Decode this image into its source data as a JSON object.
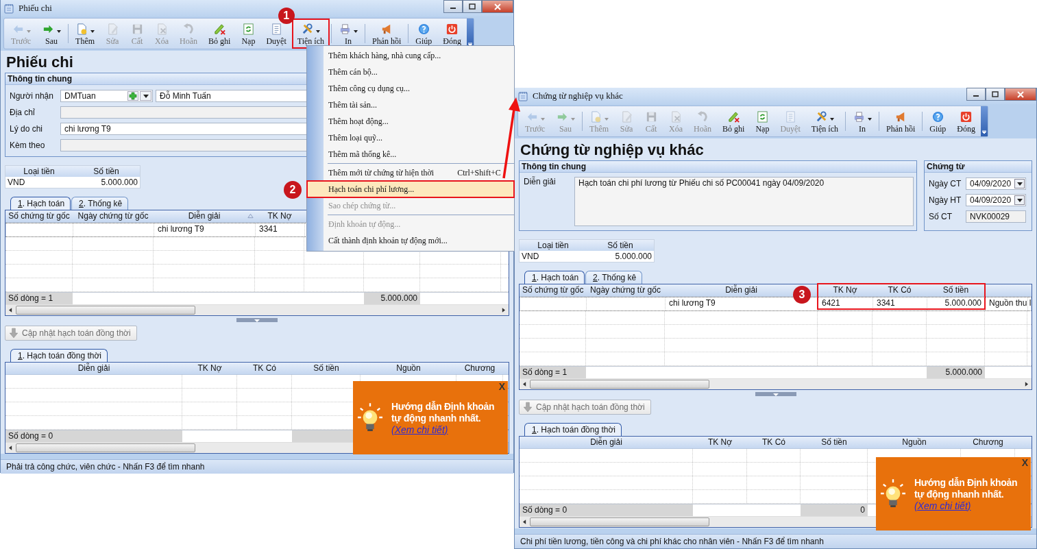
{
  "windows": [
    {
      "title": "Phiếu chi",
      "toolbar": [
        [
          {
            "label": "Trước",
            "disabled": true,
            "dropdown": true
          },
          {
            "label": "Sau",
            "disabled": false,
            "dropdown": true
          }
        ],
        [
          {
            "label": "Thêm",
            "disabled": false,
            "dropdown": true
          },
          {
            "label": "Sửa",
            "disabled": true,
            "dropdown": false
          },
          {
            "label": "Cất",
            "disabled": true,
            "dropdown": false
          },
          {
            "label": "Xóa",
            "disabled": true,
            "dropdown": false
          },
          {
            "label": "Hoãn",
            "disabled": true,
            "dropdown": false
          },
          {
            "label": "Bỏ ghi",
            "disabled": false,
            "dropdown": false
          },
          {
            "label": "Nạp",
            "disabled": false,
            "dropdown": false
          },
          {
            "label": "Duyệt",
            "disabled": false,
            "dropdown": false
          },
          {
            "label": "Tiện ích",
            "disabled": false,
            "dropdown": true,
            "callout": "1"
          }
        ],
        [
          {
            "label": "In",
            "disabled": false,
            "dropdown": true
          }
        ],
        [
          {
            "label": "Phản hồi",
            "disabled": false,
            "dropdown": false
          }
        ],
        [
          {
            "label": "Giúp",
            "disabled": false,
            "dropdown": false
          },
          {
            "label": "Đóng",
            "disabled": false,
            "dropdown": false
          }
        ]
      ],
      "heading": "Phiếu chi",
      "general": {
        "title": "Thông tin chung",
        "fields": [
          {
            "kind": "lookup",
            "label": "Người nhận",
            "value": "DMTuan",
            "name_value": "Đỗ Minh Tuấn"
          },
          {
            "kind": "text",
            "label": "Địa chỉ"
          },
          {
            "kind": "text",
            "label": "Lý do chi",
            "value": "chi lương T9"
          },
          {
            "kind": "text",
            "label": "Kèm theo"
          }
        ]
      },
      "currency": {
        "columns": [
          "Loại tiền",
          "Số tiền"
        ],
        "row": [
          "VND",
          "5.000.000"
        ]
      },
      "tabs": [
        {
          "label": "1. Hạch toán",
          "selected": true
        },
        {
          "label": "2. Thống kê",
          "selected": false
        }
      ],
      "grid": {
        "columns": [
          "Số chứng từ gốc",
          "Ngày chứng từ gốc",
          "Diễn giải",
          "TK Nợ"
        ],
        "sort_ascending": true,
        "rows": [
          [
            null,
            null,
            "chi lương T9",
            "3341"
          ]
        ],
        "footer": {
          "count": "Số dòng = 1",
          "total": "5.000.000"
        }
      },
      "update_button": {
        "label": "Cập nhật hạch toán đồng thời",
        "disabled": true
      },
      "tabs2": [
        {
          "label": "1. Hạch toán đồng thời",
          "selected": true
        }
      ],
      "grid2": {
        "columns": [
          "Diễn giải",
          "TK Nợ",
          "TK Có",
          "Số tiền",
          "Nguồn",
          "Chương"
        ],
        "footer": {
          "count": "Số dòng = 0"
        }
      },
      "popup": {
        "title": "Hướng dẫn Định khoản tự động nhanh nhất.",
        "link": "(Xem chi tiết)",
        "close": "X"
      },
      "status": "Phải trả công chức, viên chức - Nhấn F3 để tìm nhanh"
    },
    {
      "title": "Chứng từ nghiệp vụ khác",
      "toolbar": [
        [
          {
            "label": "Trước",
            "disabled": true,
            "dropdown": true
          },
          {
            "label": "Sau",
            "disabled": true,
            "dropdown": true
          }
        ],
        [
          {
            "label": "Thêm",
            "disabled": true,
            "dropdown": true
          },
          {
            "label": "Sửa",
            "disabled": true,
            "dropdown": false
          },
          {
            "label": "Cất",
            "disabled": true,
            "dropdown": false
          },
          {
            "label": "Xóa",
            "disabled": true,
            "dropdown": false
          },
          {
            "label": "Hoãn",
            "disabled": true,
            "dropdown": false
          },
          {
            "label": "Bỏ ghi",
            "disabled": false,
            "dropdown": false
          },
          {
            "label": "Nạp",
            "disabled": false,
            "dropdown": false
          },
          {
            "label": "Duyệt",
            "disabled": true,
            "dropdown": false
          },
          {
            "label": "Tiện ích",
            "disabled": false,
            "dropdown": true
          }
        ],
        [
          {
            "label": "In",
            "disabled": false,
            "dropdown": true
          }
        ],
        [
          {
            "label": "Phản hồi",
            "disabled": false,
            "dropdown": false
          }
        ],
        [
          {
            "label": "Giúp",
            "disabled": false,
            "dropdown": false
          },
          {
            "label": "Đóng",
            "disabled": false,
            "dropdown": false
          }
        ]
      ],
      "heading": "Chứng từ nghiệp vụ khác",
      "general": {
        "title": "Thông tin chung",
        "fields": [
          {
            "kind": "memo",
            "label": "Diễn giải",
            "value": "Hạch toán chi phí lương từ Phiếu chi số PC00041 ngày 04/09/2020"
          }
        ]
      },
      "voucher": {
        "title": "Chứng từ",
        "fields": [
          {
            "kind": "date",
            "label": "Ngày CT",
            "value": "04/09/2020"
          },
          {
            "kind": "date",
            "label": "Ngày HT",
            "value": "04/09/2020"
          },
          {
            "kind": "readonly",
            "label": "Số CT",
            "value": "NVK00029"
          }
        ]
      },
      "currency": {
        "columns": [
          "Loại tiền",
          "Số tiền"
        ],
        "row": [
          "VND",
          "5.000.000"
        ]
      },
      "tabs": [
        {
          "label": "1. Hạch toán",
          "selected": true
        },
        {
          "label": "2. Thống kê",
          "selected": false
        }
      ],
      "grid": {
        "columns": [
          "Số chứng từ gốc",
          "Ngày chứng từ gốc",
          "Diễn giải",
          "TK Nợ",
          "TK Có",
          "Số tiền",
          null
        ],
        "rows": [
          [
            null,
            null,
            "chi lương T9",
            "6421",
            "3341",
            "5.000.000",
            "Nguồn thu l"
          ]
        ],
        "footer": {
          "count": "Số dòng = 1",
          "total": "5.000.000"
        },
        "callout": "3"
      },
      "update_button": {
        "label": "Cập nhật hạch toán đồng thời",
        "disabled": true
      },
      "tabs2": [
        {
          "label": "1. Hạch toán đồng thời",
          "selected": true
        }
      ],
      "grid2": {
        "columns": [
          "Diễn giải",
          "TK Nợ",
          "TK Có",
          "Số tiền",
          "Nguồn",
          "Chương"
        ],
        "footer": {
          "count": "Số dòng = 0",
          "total": "0"
        }
      },
      "popup": {
        "title": "Hướng dẫn Định khoản tự động nhanh nhất.",
        "link": "(Xem chi tiết)",
        "close": "X"
      },
      "status": "Chi phí tiền lương, tiền công và chi phí khác cho nhân viên - Nhấn F3 để tìm nhanh"
    }
  ],
  "menu": {
    "items": [
      {
        "kind": "item",
        "label": "Thêm khách hàng, nhà cung cấp...",
        "disabled": false,
        "selected": false
      },
      {
        "kind": "item",
        "label": "Thêm cán bộ...",
        "disabled": false,
        "selected": false
      },
      {
        "kind": "item",
        "label": "Thêm công cụ dụng cụ...",
        "disabled": false,
        "selected": false
      },
      {
        "kind": "item",
        "label": "Thêm tài sản...",
        "disabled": false,
        "selected": false
      },
      {
        "kind": "item",
        "label": "Thêm hoạt động...",
        "disabled": false,
        "selected": false
      },
      {
        "kind": "item",
        "label": "Thêm loại quỹ...",
        "disabled": false,
        "selected": false
      },
      {
        "kind": "item",
        "label": "Thêm mã thống kê...",
        "disabled": false,
        "selected": false
      },
      {
        "kind": "separator"
      },
      {
        "kind": "item",
        "label": "Thêm mới từ chứng từ hiện thời",
        "shortcut": "Ctrl+Shift+C",
        "disabled": false,
        "selected": false
      },
      {
        "kind": "item",
        "label": "Hạch toán chi phí lương...",
        "disabled": false,
        "selected": true,
        "callout": "2"
      },
      {
        "kind": "item",
        "label": "Sao chép chứng từ...",
        "disabled": true,
        "selected": false
      },
      {
        "kind": "separator"
      },
      {
        "kind": "item",
        "label": "Định khoản tự động...",
        "disabled": true,
        "selected": false
      },
      {
        "kind": "item",
        "label": "Cất thành định khoản tự động mới...",
        "disabled": false,
        "selected": false
      }
    ]
  }
}
